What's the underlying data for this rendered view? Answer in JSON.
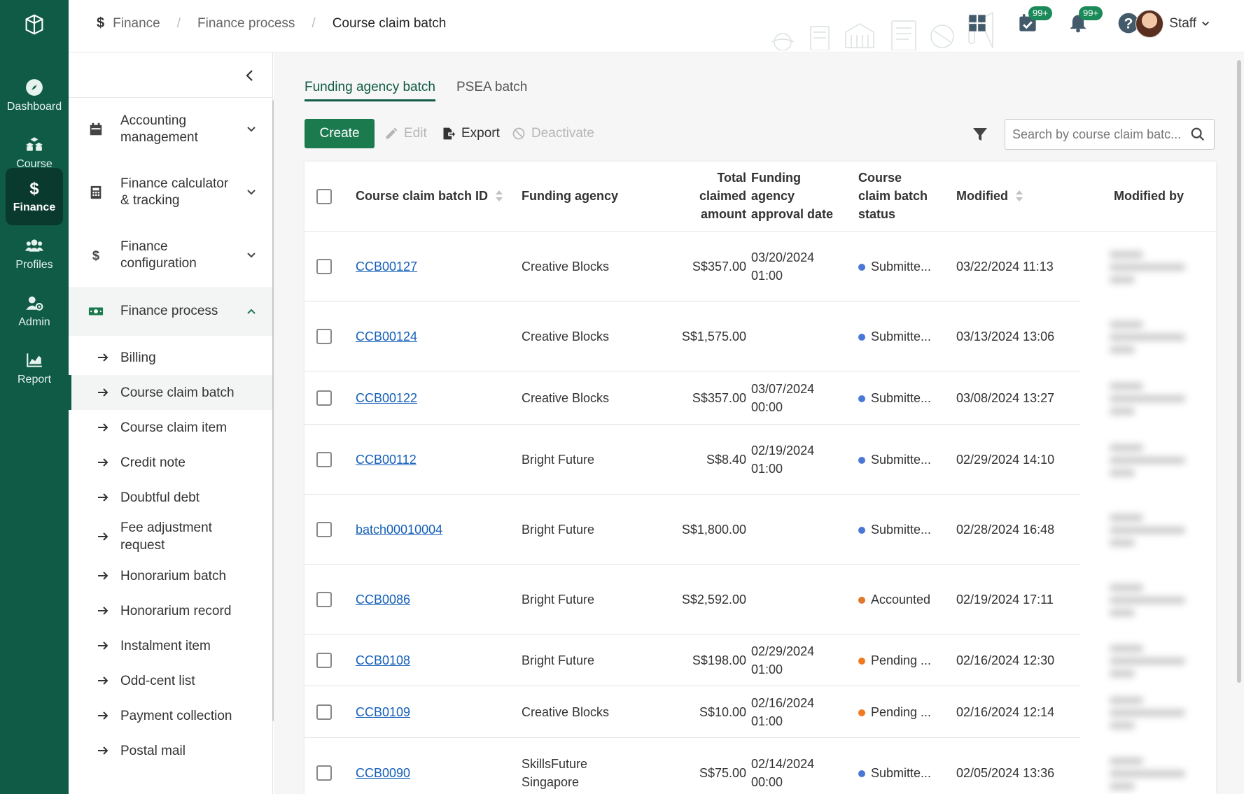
{
  "rail": {
    "items": [
      {
        "label": "Dashboard",
        "icon": "compass-icon"
      },
      {
        "label": "Course",
        "icon": "cubes-icon"
      },
      {
        "label": "Finance",
        "icon": "dollar-icon"
      },
      {
        "label": "Profiles",
        "icon": "users-icon"
      },
      {
        "label": "Admin",
        "icon": "user-gear-icon"
      },
      {
        "label": "Report",
        "icon": "chart-icon"
      }
    ]
  },
  "breadcrumb": {
    "items": [
      "Finance",
      "Finance process",
      "Course claim batch"
    ],
    "separator": "/"
  },
  "topbar": {
    "tasks_badge": "99+",
    "notifications_badge": "99+",
    "user_label": "Staff"
  },
  "sidebar": {
    "groups": [
      {
        "label": "Accounting management"
      },
      {
        "label": "Finance calculator & tracking"
      },
      {
        "label": "Finance configuration"
      },
      {
        "label": "Finance process"
      }
    ],
    "group_lines": {
      "accounting": [
        "Accounting",
        "management"
      ],
      "calculator": [
        "Finance calculator",
        "& tracking"
      ],
      "configuration": [
        "Finance",
        "configuration"
      ]
    },
    "sub_items": [
      "Billing",
      "Course claim batch",
      "Course claim item",
      "Credit note",
      "Doubtful debt",
      "Fee adjustment request",
      "Honorarium batch",
      "Honorarium record",
      "Instalment item",
      "Odd-cent list",
      "Payment collection",
      "Postal mail"
    ],
    "fee_lines": [
      "Fee adjustment",
      "request"
    ]
  },
  "tabs": [
    "Funding agency batch",
    "PSEA batch"
  ],
  "toolbar": {
    "create": "Create",
    "edit": "Edit",
    "export": "Export",
    "deactivate": "Deactivate",
    "search_placeholder": "Search by course claim batc..."
  },
  "table": {
    "headers": {
      "id": "Course claim batch ID",
      "agency": "Funding agency",
      "total_l1": "Total",
      "total_l2": "claimed",
      "total_l3": "amount",
      "approval_l1": "Funding",
      "approval_l2": "agency",
      "approval_l3": "approval date",
      "status_l1": "Course",
      "status_l2": "claim batch",
      "status_l3": "status",
      "modified": "Modified",
      "modified_by": "Modified by"
    },
    "rows": [
      {
        "id": "CCB00127",
        "agency": [
          "Creative Blocks"
        ],
        "amount": "S$357.00",
        "approval": [
          "03/20/2024",
          "01:00"
        ],
        "status": "Submitte...",
        "status_color": "#4a78d6",
        "modified": "03/22/2024 11:13"
      },
      {
        "id": "CCB00124",
        "agency": [
          "Creative Blocks"
        ],
        "amount": "S$1,575.00",
        "approval": [],
        "status": "Submitte...",
        "status_color": "#4a78d6",
        "modified": "03/13/2024 13:06"
      },
      {
        "id": "CCB00122",
        "agency": [
          "Creative Blocks"
        ],
        "amount": "S$357.00",
        "approval": [
          "03/07/2024",
          "00:00"
        ],
        "status": "Submitte...",
        "status_color": "#4a78d6",
        "modified": "03/08/2024 13:27"
      },
      {
        "id": "CCB00112",
        "agency": [
          "Bright Future"
        ],
        "amount": "S$8.40",
        "approval": [
          "02/19/2024",
          "01:00"
        ],
        "status": "Submitte...",
        "status_color": "#4a78d6",
        "modified": "02/29/2024 14:10"
      },
      {
        "id": "batch00010004",
        "agency": [
          "Bright Future"
        ],
        "amount": "S$1,800.00",
        "approval": [],
        "status": "Submitte...",
        "status_color": "#4a78d6",
        "modified": "02/28/2024 16:48"
      },
      {
        "id": "CCB0086",
        "agency": [
          "Bright Future"
        ],
        "amount": "S$2,592.00",
        "approval": [],
        "status": "Accounted",
        "status_color": "#e0782a",
        "modified": "02/19/2024 17:11"
      },
      {
        "id": "CCB0108",
        "agency": [
          "Bright Future"
        ],
        "amount": "S$198.00",
        "approval": [
          "02/29/2024",
          "01:00"
        ],
        "status": "Pending ...",
        "status_color": "#f07a22",
        "modified": "02/16/2024 12:30"
      },
      {
        "id": "CCB0109",
        "agency": [
          "Creative Blocks"
        ],
        "amount": "S$10.00",
        "approval": [
          "02/16/2024",
          "01:00"
        ],
        "status": "Pending ...",
        "status_color": "#f07a22",
        "modified": "02/16/2024 12:14"
      },
      {
        "id": "CCB0090",
        "agency": [
          "SkillsFuture",
          "Singapore"
        ],
        "amount": "S$75.00",
        "approval": [
          "02/14/2024",
          "00:00"
        ],
        "status": "Submitte...",
        "status_color": "#4a78d6",
        "modified": "02/05/2024 13:36"
      }
    ]
  }
}
